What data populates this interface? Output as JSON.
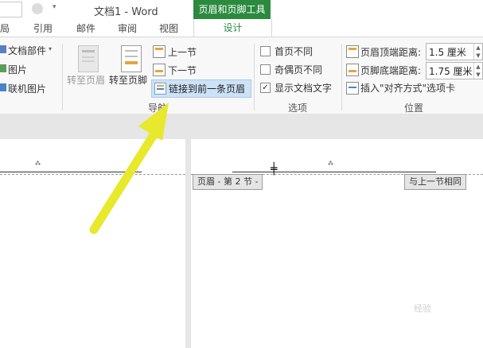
{
  "title_bar": {
    "document_title": "文档1 - Word",
    "context_group": "页眉和页脚工具"
  },
  "tabs": [
    {
      "label": "局",
      "key": "tab-layout-partial"
    },
    {
      "label": "引用",
      "key": "tab-references"
    },
    {
      "label": "邮件",
      "key": "tab-mailings"
    },
    {
      "label": "审阅",
      "key": "tab-review"
    },
    {
      "label": "视图",
      "key": "tab-view"
    },
    {
      "label": "设计",
      "key": "tab-design"
    }
  ],
  "ribbon": {
    "insert": {
      "doc_parts": "文档部件",
      "picture": "图片",
      "online_picture": "联机图片"
    },
    "navigation": {
      "goto_header": "转至页眉",
      "goto_footer": "转至页脚",
      "previous_section": "上一节",
      "next_section": "下一节",
      "link_to_previous": "链接到前一条页眉",
      "group_label": "导航"
    },
    "options": {
      "different_first_page": "首页不同",
      "different_odd_even": "奇偶页不同",
      "show_document_text": "显示文档文字",
      "show_document_text_checked": true,
      "group_label": "选项"
    },
    "position": {
      "header_from_top_label": "页眉顶端距离:",
      "header_from_top_value": "1.5 厘米",
      "footer_from_bottom_label": "页脚底端距离:",
      "footer_from_bottom_value": "1.75 厘米",
      "insert_alignment_tab": "插入\"对齐方式\"选项卡",
      "group_label": "位置"
    }
  },
  "document": {
    "header_label": "页眉 - 第 2 节 -",
    "same_as_previous": "与上一节相同"
  },
  "watermark": "经验"
}
